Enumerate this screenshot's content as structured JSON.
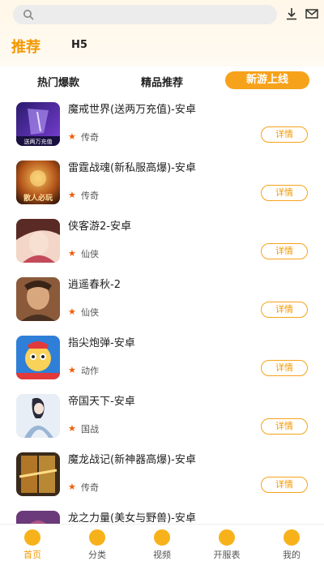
{
  "header": {
    "search_placeholder": "",
    "tabs": [
      "推荐",
      "H5"
    ]
  },
  "subtabs": [
    "热门爆款",
    "精品推荐",
    "新游上线"
  ],
  "games": [
    {
      "title": "魔戒世界(送两万充值)-安卓",
      "category": "传奇",
      "button": "详情",
      "cover_text": "送两万充值"
    },
    {
      "title": "雷霆战魂(新私服高爆)-安卓",
      "category": "传奇",
      "button": "详情",
      "cover_text": "散人必玩"
    },
    {
      "title": "侠客游2-安卓",
      "category": "仙侠",
      "button": "详情"
    },
    {
      "title": "逍遥春秋-2",
      "category": "仙侠",
      "button": "详情"
    },
    {
      "title": "指尖炮弹-安卓",
      "category": "动作",
      "button": "详情"
    },
    {
      "title": "帝国天下-安卓",
      "category": "国战",
      "button": "详情"
    },
    {
      "title": "魔龙战记(新神器高爆)-安卓",
      "category": "传奇",
      "button": "详情"
    },
    {
      "title": "龙之力量(美女与野兽)-安卓",
      "category": "",
      "button": ""
    }
  ],
  "bottom_nav": [
    "首页",
    "分类",
    "视频",
    "开服表",
    "我的"
  ],
  "colors": {
    "accent": "#f39800",
    "button_bg": "#f7a21b",
    "star": "#f25c05"
  },
  "icons": [
    "search-icon",
    "download-icon",
    "mail-icon",
    "star-icon",
    "home-icon",
    "category-icon",
    "video-icon",
    "server-list-icon",
    "profile-icon"
  ]
}
